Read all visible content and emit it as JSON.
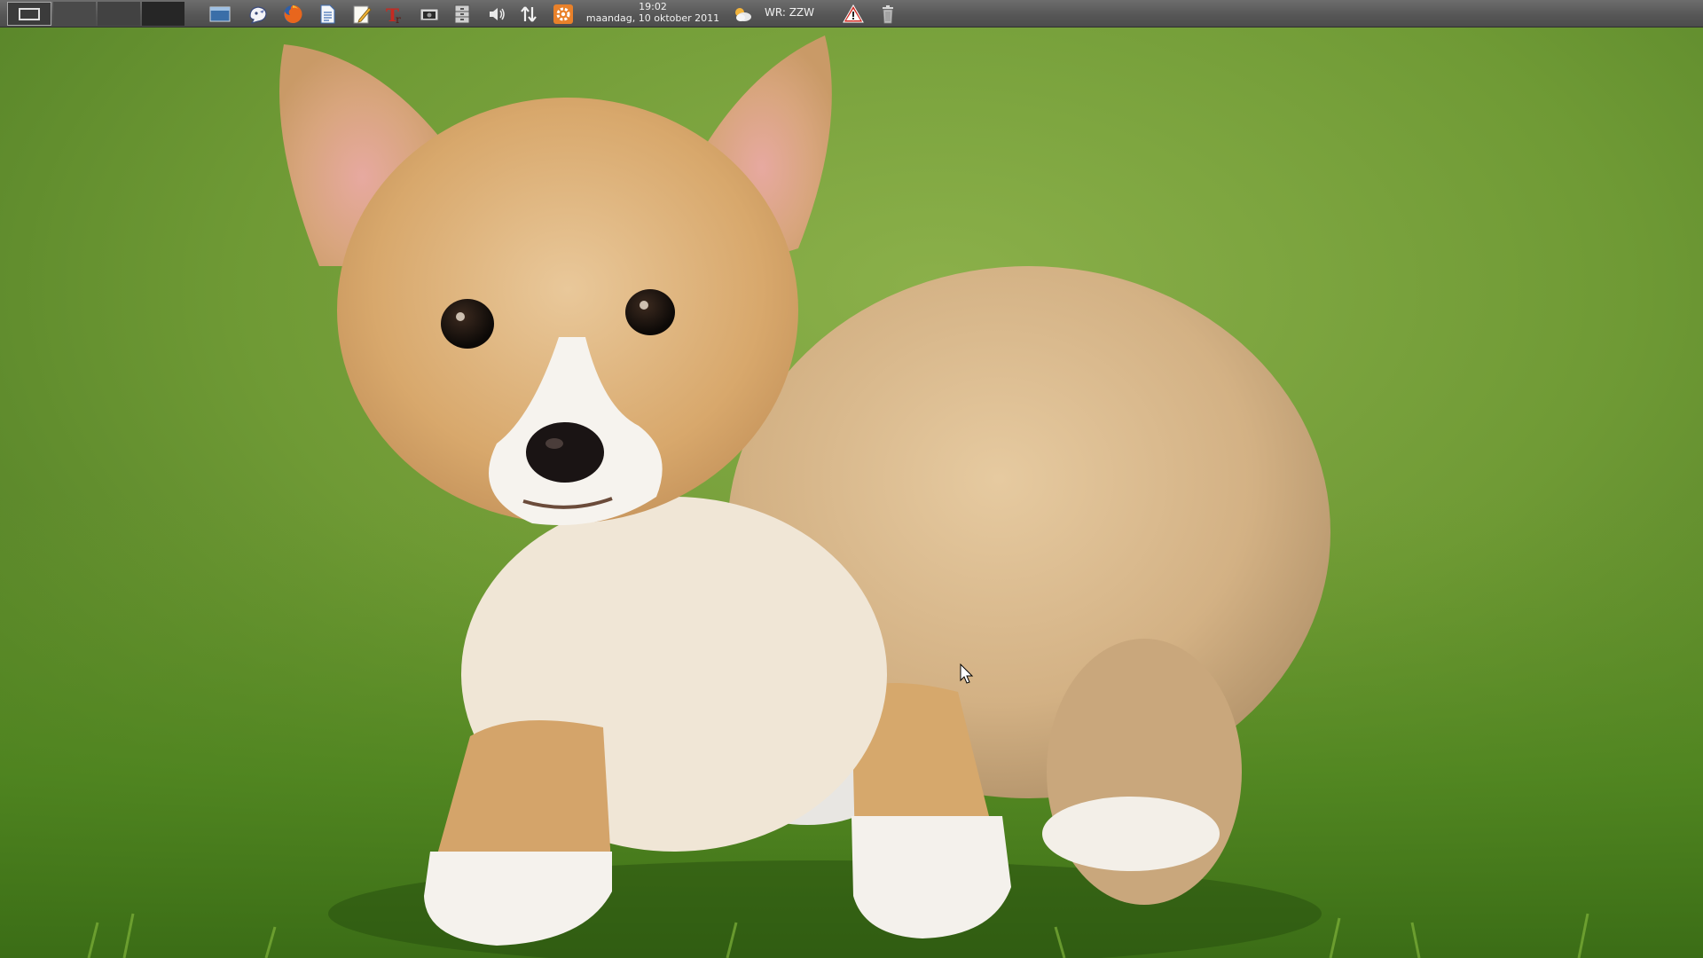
{
  "panel": {
    "workspaces": [
      "1",
      "2",
      "3",
      "4"
    ],
    "launchers": [
      {
        "name": "show-desktop-icon"
      },
      {
        "name": "pidgin-icon"
      },
      {
        "name": "firefox-icon"
      },
      {
        "name": "text-document-icon"
      },
      {
        "name": "text-editor-icon"
      },
      {
        "name": "font-tool-icon"
      },
      {
        "name": "screenshot-icon"
      },
      {
        "name": "file-cabinet-icon"
      }
    ],
    "tray": {
      "volume_icon": "volume-icon",
      "network_icon": "network-transfer-icon",
      "settings_icon": "settings-icon"
    },
    "clock": {
      "time": "19:02",
      "date": "maandag, 10 oktober 2011"
    },
    "weather": {
      "icon": "weather-partly-cloudy-icon",
      "text": "WR: ZZW"
    },
    "warning_icon": "warning-icon",
    "trash_icon": "trash-icon"
  },
  "desktop": {
    "wallpaper": "corgi-puppy-on-grass",
    "colors": {
      "grass": "#5e8f2c",
      "fur": "#d9b88a",
      "panel": "#5a5a5a"
    }
  }
}
